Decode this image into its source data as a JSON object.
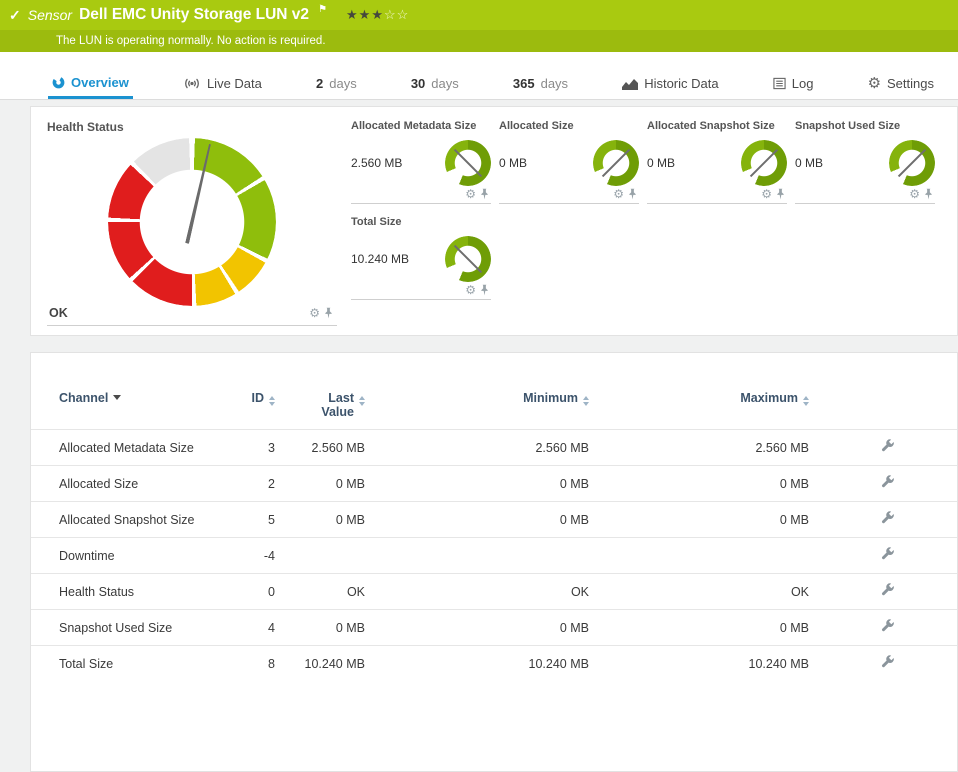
{
  "header": {
    "status_icon": "✓",
    "kind_label": "Sensor",
    "title": "Dell EMC Unity Storage LUN v2",
    "stars_filled_str": "★★★",
    "stars_empty_str": "☆☆",
    "stars_filled": 3,
    "stars_total": 5,
    "message": "The LUN is operating normally. No action is required."
  },
  "tabs": [
    {
      "label": "Overview",
      "active": true
    },
    {
      "label": "Live Data"
    },
    {
      "num": "2",
      "label": "days"
    },
    {
      "num": "30",
      "label": "days"
    },
    {
      "num": "365",
      "label": "days"
    },
    {
      "label": "Historic Data"
    },
    {
      "label": "Log"
    },
    {
      "label": "Settings"
    }
  ],
  "health": {
    "title": "Health Status",
    "status": "OK",
    "needle_deg": 13
  },
  "gauges": [
    {
      "label": "Allocated Metadata Size",
      "value": "2.560 MB",
      "needle_deg": 135
    },
    {
      "label": "Allocated Size",
      "value": "0 MB",
      "needle_deg": 225
    },
    {
      "label": "Allocated Snapshot Size",
      "value": "0 MB",
      "needle_deg": 225
    },
    {
      "label": "Snapshot Used Size",
      "value": "0 MB",
      "needle_deg": 225
    },
    {
      "label": "Total Size",
      "value": "10.240 MB",
      "needle_deg": 135
    }
  ],
  "table": {
    "columns": [
      "Channel",
      "ID",
      "Last Value",
      "Minimum",
      "Maximum"
    ],
    "sorted": {
      "column": "Channel",
      "direction": "desc"
    },
    "rows": [
      {
        "channel": "Allocated Metadata Size",
        "id": "3",
        "last": "2.560 MB",
        "min": "2.560 MB",
        "max": "2.560 MB"
      },
      {
        "channel": "Allocated Size",
        "id": "2",
        "last": "0 MB",
        "min": "0 MB",
        "max": "0 MB"
      },
      {
        "channel": "Allocated Snapshot Size",
        "id": "5",
        "last": "0 MB",
        "min": "0 MB",
        "max": "0 MB"
      },
      {
        "channel": "Downtime",
        "id": "-4",
        "last": "",
        "min": "",
        "max": ""
      },
      {
        "channel": "Health Status",
        "id": "0",
        "last": "OK",
        "min": "OK",
        "max": "OK"
      },
      {
        "channel": "Snapshot Used Size",
        "id": "4",
        "last": "0 MB",
        "min": "0 MB",
        "max": "0 MB"
      },
      {
        "channel": "Total Size",
        "id": "8",
        "last": "10.240 MB",
        "min": "10.240 MB",
        "max": "10.240 MB"
      }
    ]
  },
  "icons": {
    "header": [
      "check-icon",
      "flag-icon",
      "star-icon"
    ],
    "tabs": [
      "overview-donut-icon",
      "live-data-broadcast-icon",
      "historic-data-chart-icon",
      "log-list-icon",
      "settings-gear-icon"
    ],
    "gauges": [
      "gear-icon",
      "pin-icon"
    ],
    "table": [
      "sort-icon",
      "channel-settings-wrench-icon"
    ]
  },
  "colors": {
    "header_green": "#a9ca10",
    "header_green_dark": "#9cbb0e",
    "accent_blue": "#1b92d0",
    "gauge_green": "#8fbe0c",
    "gauge_yellow": "#f2c400",
    "gauge_red": "#e01d1d",
    "gauge_gray": "#e4e4e4",
    "mini_gauge_green": "#6f9d06"
  }
}
